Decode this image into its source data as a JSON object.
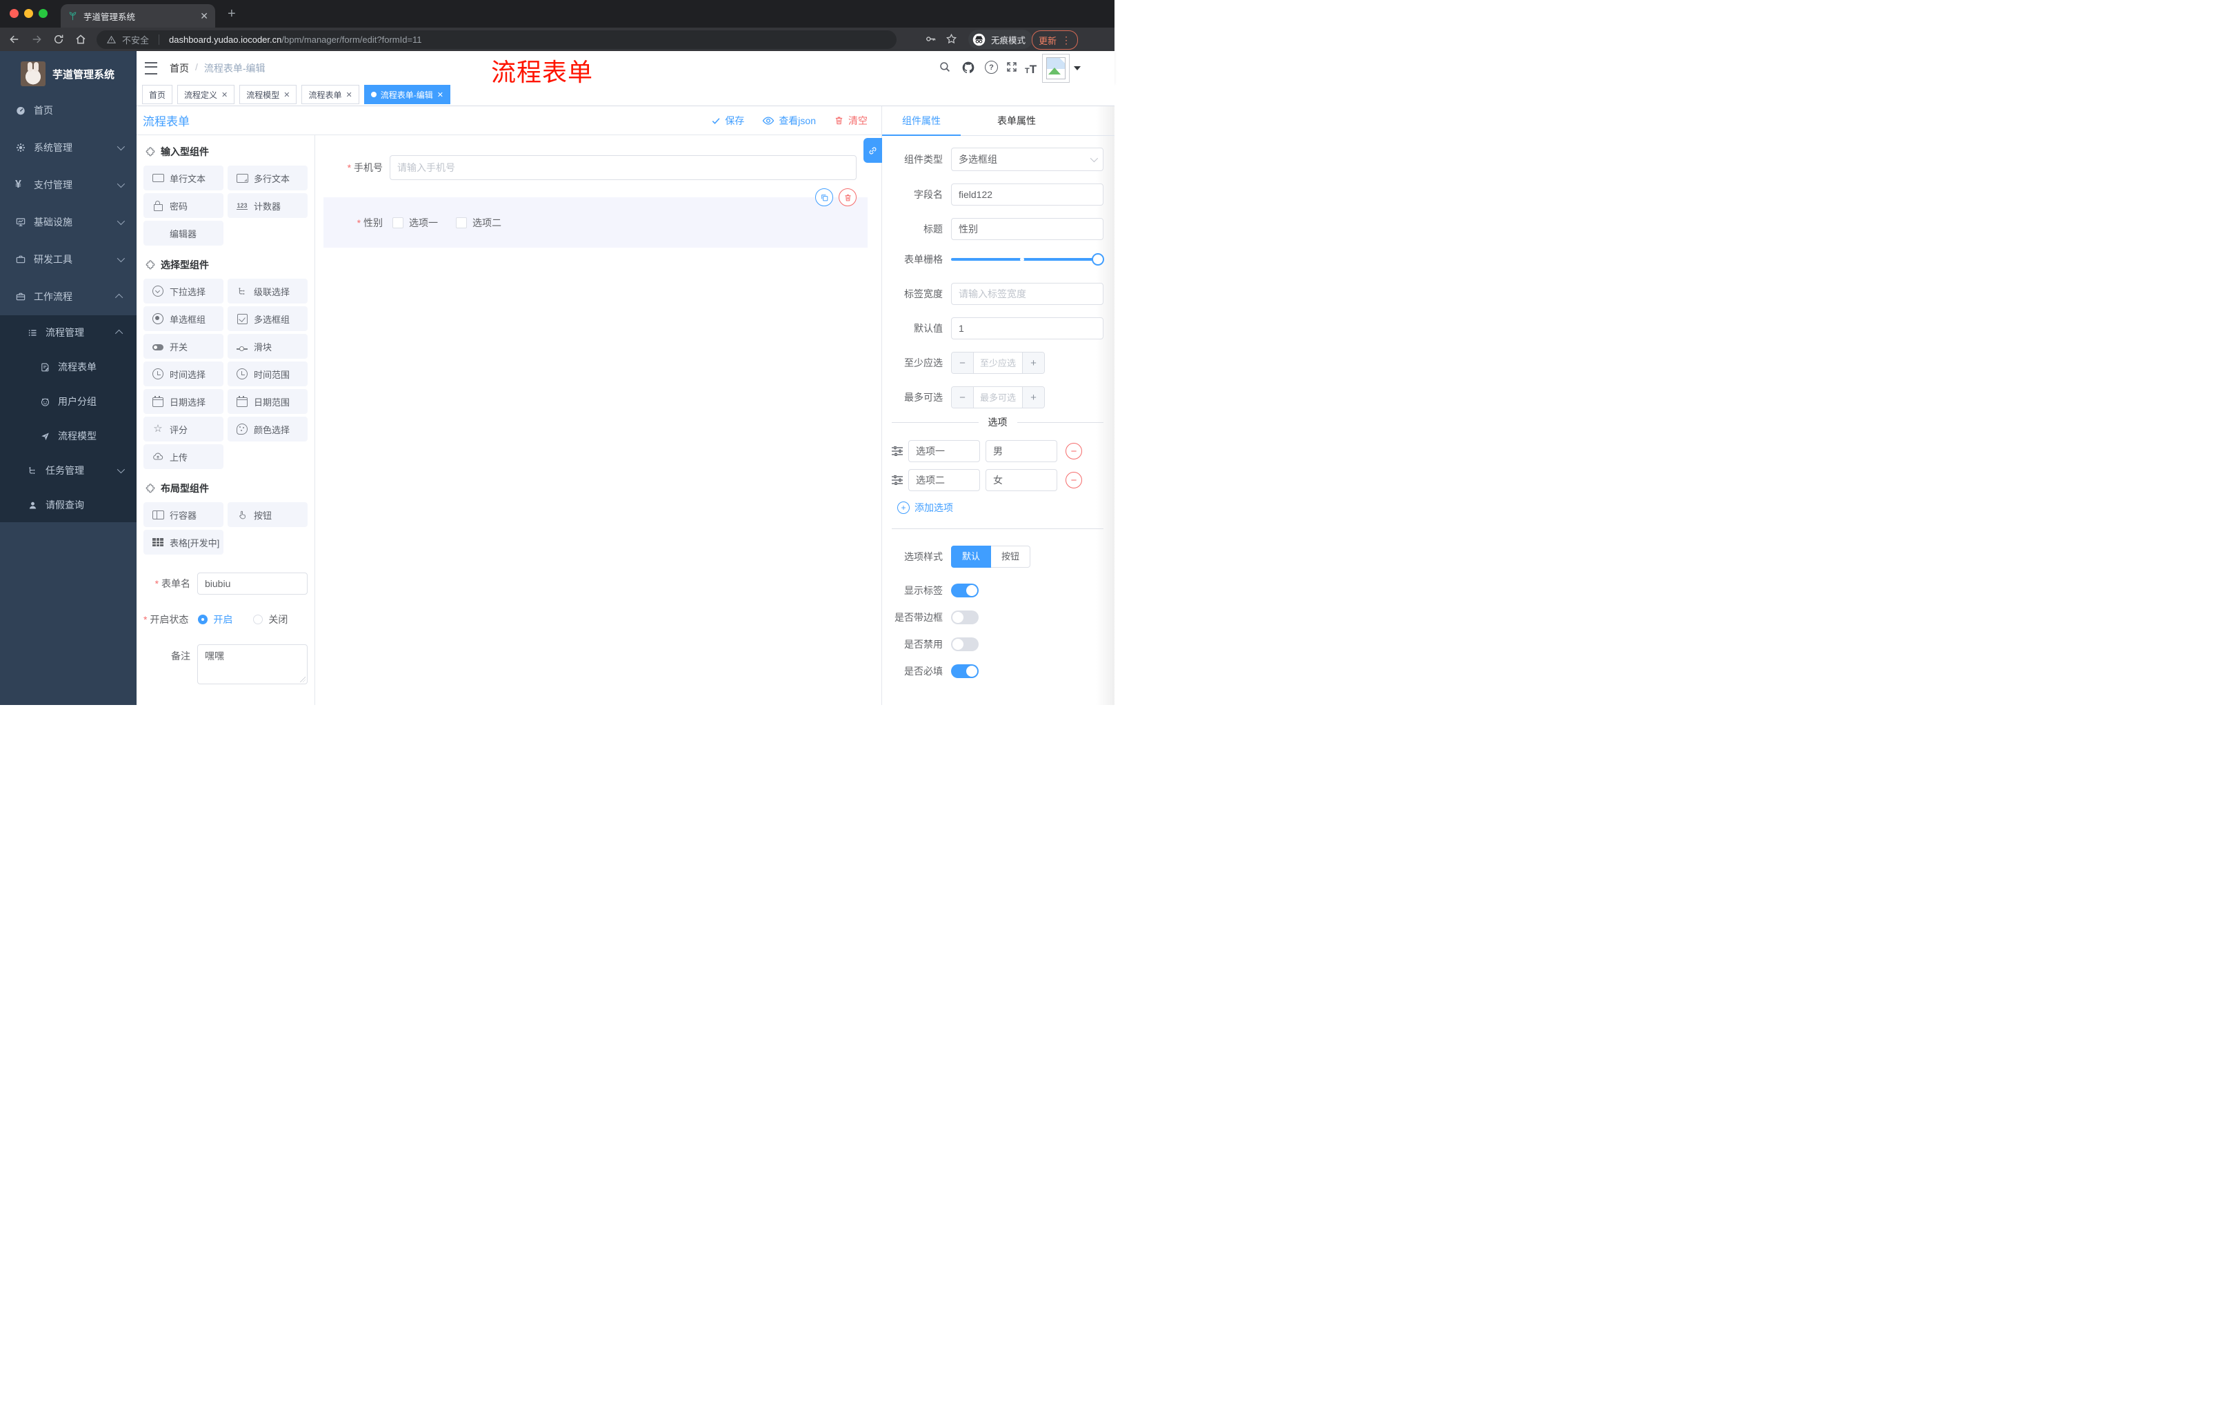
{
  "browser": {
    "tab_title": "芋道管理系统",
    "security_label": "不安全",
    "url_domain": "dashboard.yudao.iocoder.cn",
    "url_path": "/bpm/manager/form/edit?formId=11",
    "incognito_label": "无痕模式",
    "update_label": "更新"
  },
  "navbar": {
    "breadcrumb_home": "首页",
    "breadcrumb_current": "流程表单-编辑",
    "annotation": "流程表单"
  },
  "tags": [
    {
      "label": "首页"
    },
    {
      "label": "流程定义"
    },
    {
      "label": "流程模型"
    },
    {
      "label": "流程表单"
    },
    {
      "label": "流程表单-编辑"
    }
  ],
  "sidebar": {
    "app_title": "芋道管理系统",
    "home": "首页",
    "system_mgmt": "系统管理",
    "payment_mgmt": "支付管理",
    "infrastructure": "基础设施",
    "dev_tools": "研发工具",
    "workflow": "工作流程",
    "process_mgmt": "流程管理",
    "process_form": "流程表单",
    "user_group": "用户分组",
    "process_model": "流程模型",
    "task_mgmt": "任务管理",
    "leave_query": "请假查询"
  },
  "editor": {
    "title": "流程表单",
    "save": "保存",
    "view_json": "查看json",
    "clear": "清空"
  },
  "palette": {
    "input_group": "输入型组件",
    "input_items": [
      "单行文本",
      "多行文本",
      "密码",
      "计数器",
      "编辑器"
    ],
    "select_group": "选择型组件",
    "select_items": [
      "下拉选择",
      "级联选择",
      "单选框组",
      "多选框组",
      "开关",
      "滑块",
      "时间选择",
      "时间范围",
      "日期选择",
      "日期范围",
      "评分",
      "颜色选择",
      "上传"
    ],
    "layout_group": "布局型组件",
    "layout_items": [
      "行容器",
      "按钮",
      "表格[开发中]"
    ]
  },
  "form_meta": {
    "name_label": "表单名",
    "name_value": "biubiu",
    "status_label": "开启状态",
    "status_on": "开启",
    "status_off": "关闭",
    "remark_label": "备注",
    "remark_value": "嘿嘿"
  },
  "canvas": {
    "phone_label": "手机号",
    "phone_placeholder": "请输入手机号",
    "gender_label": "性别",
    "gender_option1": "选项一",
    "gender_option2": "选项二"
  },
  "props": {
    "tab_component": "组件属性",
    "tab_form": "表单属性",
    "type_label": "组件类型",
    "type_value": "多选框组",
    "field_label": "字段名",
    "field_value": "field122",
    "title_label": "标题",
    "title_value": "性别",
    "grid_label": "表单栅格",
    "label_width_label": "标签宽度",
    "label_width_placeholder": "请输入标签宽度",
    "default_label": "默认值",
    "default_value": "1",
    "min_label": "至少应选",
    "min_placeholder": "至少应选",
    "max_label": "最多可选",
    "max_placeholder": "最多可选",
    "options_title": "选项",
    "option1_label": "选项一",
    "option1_value": "男",
    "option2_label": "选项二",
    "option2_value": "女",
    "add_option": "添加选项",
    "style_label": "选项样式",
    "style_default": "默认",
    "style_button": "按钮",
    "show_label": "显示标签",
    "with_border": "是否带边框",
    "disabled": "是否禁用",
    "required": "是否必填"
  },
  "colors": {
    "primary": "#409EFF",
    "danger": "#F56C6C",
    "sidebar_bg": "#304156",
    "submenu_bg": "#1F2D3D",
    "annotation_red": "#FE1400"
  }
}
